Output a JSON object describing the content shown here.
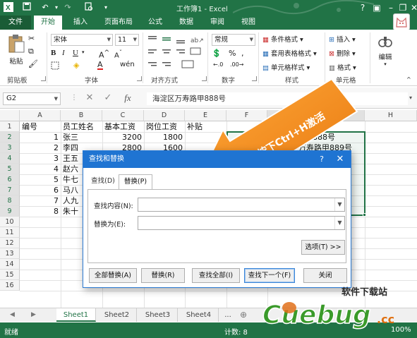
{
  "colors": {
    "excel_green": "#217346",
    "callout_orange": "#f08a1c",
    "dialog_blue": "#1f74d2",
    "selection_green": "#217346"
  },
  "titlebar": {
    "title": "工作簿1 - Excel",
    "icons": [
      "excel-logo-icon",
      "save-icon",
      "undo-icon",
      "redo-icon",
      "print-preview-icon",
      "customize-qat-icon"
    ],
    "window_controls": [
      "help-icon",
      "ribbon-display-icon",
      "minimize-icon",
      "restore-icon",
      "close-icon"
    ]
  },
  "tabs": [
    {
      "label": "文件"
    },
    {
      "label": "开始"
    },
    {
      "label": "插入"
    },
    {
      "label": "页面布局"
    },
    {
      "label": "公式"
    },
    {
      "label": "数据"
    },
    {
      "label": "审阅"
    },
    {
      "label": "视图"
    }
  ],
  "ribbon": {
    "clipboard": {
      "paste": "粘贴",
      "label": "剪贴板"
    },
    "font": {
      "name": "宋体",
      "size": "11",
      "label": "字体"
    },
    "alignment": {
      "label": "对齐方式"
    },
    "number": {
      "format": "常规",
      "label": "数字"
    },
    "styles": {
      "cond_format": "条件格式",
      "table_format": "套用表格格式",
      "cell_style": "单元格样式",
      "label": "样式"
    },
    "cells": {
      "insert": "插入",
      "delete": "删除",
      "format": "格式",
      "label": "单元格"
    },
    "editing": {
      "label": "编辑"
    }
  },
  "formula_bar": {
    "name_box": "G2",
    "formula": "海淀区万寿路甲888号",
    "fx": "fx"
  },
  "sheet": {
    "columns": [
      "A",
      "B",
      "C",
      "D",
      "E",
      "F",
      "G",
      "H"
    ],
    "rows": [
      "1",
      "2",
      "3",
      "4",
      "5",
      "6",
      "7",
      "8",
      "9",
      "10",
      "11",
      "12",
      "13",
      "14",
      "15",
      "16"
    ],
    "header_row": [
      "编号",
      "员工姓名",
      "基本工资",
      "岗位工资",
      "补贴"
    ],
    "data": [
      {
        "id": "1",
        "name": "张三",
        "base": "3200",
        "post": "1800",
        "g": "888号"
      },
      {
        "id": "2",
        "name": "李四",
        "base": "2800",
        "post": "1600",
        "g": "万寿路甲889号"
      },
      {
        "id": "3",
        "name": "王五",
        "base": "",
        "post": "",
        "g": ""
      },
      {
        "id": "4",
        "name": "赵六",
        "base": "",
        "post": "",
        "g": ""
      },
      {
        "id": "5",
        "name": "牛七",
        "base": "",
        "post": "",
        "g": ""
      },
      {
        "id": "6",
        "name": "马八",
        "base": "",
        "post": "",
        "g": ""
      },
      {
        "id": "7",
        "name": "人九",
        "base": "",
        "post": "",
        "g": ""
      },
      {
        "id": "8",
        "name": "朱十",
        "base": "",
        "post": "",
        "g": ""
      }
    ]
  },
  "callout": {
    "text": "按下Ctrl+H激活"
  },
  "dialog": {
    "title": "查找和替换",
    "help": "?",
    "close": "✕",
    "tab_find": "查找(D)",
    "tab_replace": "替换(P)",
    "find_label": "查找内容(N):",
    "replace_label": "替换为(E):",
    "options": "选项(T) >>",
    "replace_all": "全部替换(A)",
    "replace": "替换(R)",
    "find_all": "查找全部(I)",
    "find_next": "查找下一个(F)",
    "close_btn": "关闭"
  },
  "sheet_tabs": [
    "Sheet1",
    "Sheet2",
    "Sheet3",
    "Sheet4",
    "..."
  ],
  "status": {
    "ready": "就绪",
    "count": "计数: 8",
    "zoom": "100%"
  },
  "watermark": {
    "text_cn": "软件下载站",
    "brand": "Cuebug",
    "suffix": ".cc"
  }
}
